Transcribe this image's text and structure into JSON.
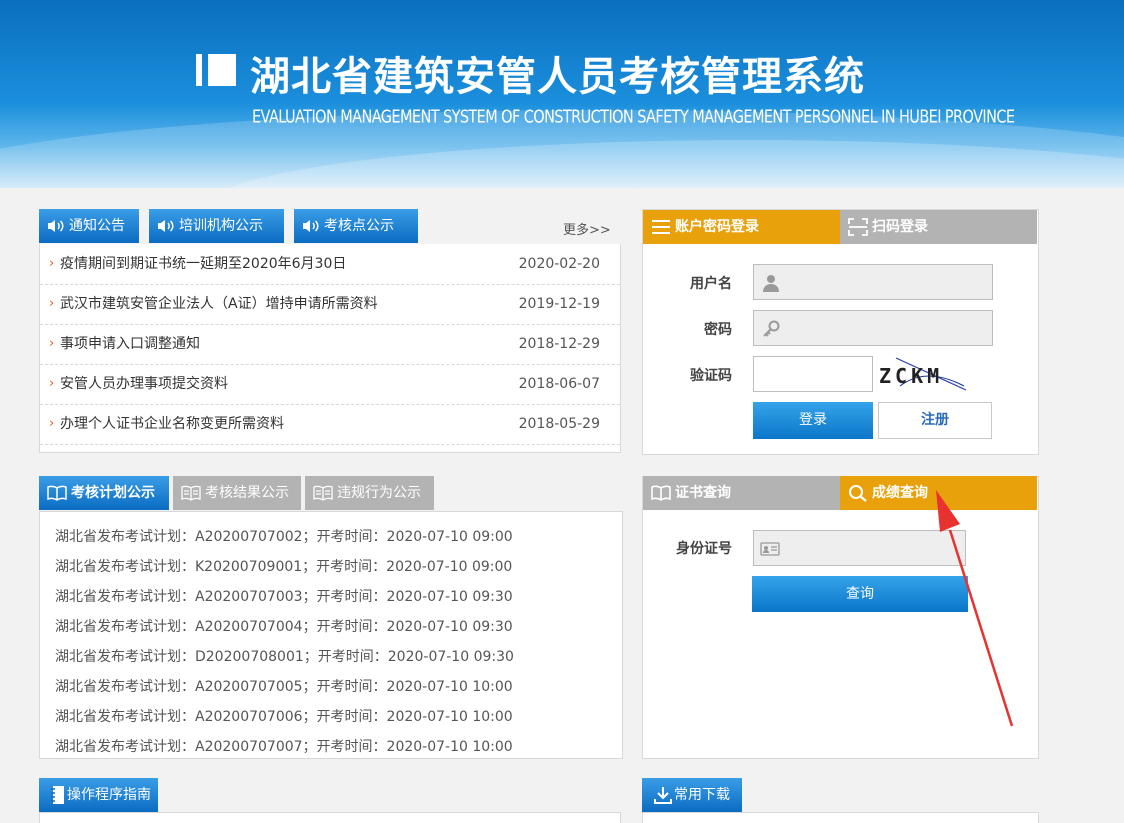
{
  "header": {
    "title_cn": "湖北省建筑安管人员考核管理系统",
    "title_en": "EVALUATION MANAGEMENT SYSTEM OF CONSTRUCTION SAFETY MANAGEMENT PERSONNEL IN HUBEI PROVINCE"
  },
  "notices": {
    "tabs": [
      "通知公告",
      "培训机构公示",
      "考核点公示"
    ],
    "more": "更多>>",
    "items": [
      {
        "title": "疫情期间到期证书统一延期至2020年6月30日",
        "date": "2020-02-20"
      },
      {
        "title": "武汉市建筑安管企业法人（A证）增持申请所需资料",
        "date": "2019-12-19"
      },
      {
        "title": "事项申请入口调整通知",
        "date": "2018-12-29"
      },
      {
        "title": "安管人员办理事项提交资料",
        "date": "2018-06-07"
      },
      {
        "title": "办理个人证书企业名称变更所需资料",
        "date": "2018-05-29"
      }
    ]
  },
  "exam": {
    "tabs": [
      "考核计划公示",
      "考核结果公示",
      "违规行为公示"
    ],
    "items": [
      "湖北省发布考试计划：A20200707002；开考时间：2020-07-10 09:00",
      "湖北省发布考试计划：K20200709001；开考时间：2020-07-10 09:00",
      "湖北省发布考试计划：A20200707003；开考时间：2020-07-10 09:30",
      "湖北省发布考试计划：A20200707004；开考时间：2020-07-10 09:30",
      "湖北省发布考试计划：D20200708001；开考时间：2020-07-10 09:30",
      "湖北省发布考试计划：A20200707005；开考时间：2020-07-10 10:00",
      "湖北省发布考试计划：A20200707006；开考时间：2020-07-10 10:00",
      "湖北省发布考试计划：A20200707007；开考时间：2020-07-10 10:00"
    ]
  },
  "login": {
    "tab_account": "账户密码登录",
    "tab_qr": "扫码登录",
    "username_label": "用户名",
    "password_label": "密码",
    "captcha_label": "验证码",
    "captcha_text": "ZCKM",
    "login_button": "登录",
    "register_button": "注册"
  },
  "query": {
    "tab_cert": "证书查询",
    "tab_score": "成绩查询",
    "id_label": "身份证号",
    "query_button": "查询"
  },
  "bottom": {
    "guide": "操作程序指南",
    "download": "常用下载"
  },
  "colors": {
    "accent_blue": "#0b6cc2",
    "accent_orange": "#e8a10a",
    "tab_grey": "#b3b3b3",
    "annotation_red": "#e8322f"
  }
}
